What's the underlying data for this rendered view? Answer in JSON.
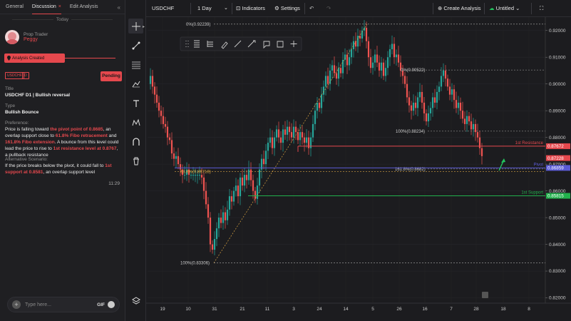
{
  "left_panel": {
    "tabs": [
      "General",
      "Discussion",
      "Edit Analysis"
    ],
    "tab_close": "×",
    "collapse": "«",
    "today": "Today",
    "author_role": "Prop Trader",
    "author_name": "Peggy",
    "status": "Analysis Created",
    "symbol_badge": "USDCHF",
    "timeframe_badge": "D",
    "pending_label": "Pending",
    "title_label": "Title",
    "title_value": "USDCHF D1 | Bullish reversal",
    "type_label": "Type",
    "type_value": "Bullish Bounce",
    "preference_label": "Preference:",
    "preference_text": [
      {
        "t": "Price is falling toward ",
        "hl": false
      },
      {
        "t": "the pivot point of 0.8685",
        "hl": true
      },
      {
        "t": ", an overlap support close to ",
        "hl": false
      },
      {
        "t": "61.8% Fibo retracement",
        "hl": true
      },
      {
        "t": " and ",
        "hl": false
      },
      {
        "t": "161.8% Fibo extension",
        "hl": true
      },
      {
        "t": ". A bounce from this level could lead the price to rise to ",
        "hl": false
      },
      {
        "t": "1st resistance level at 0.8767",
        "hl": true
      },
      {
        "t": ", a pullback resistance",
        "hl": false
      }
    ],
    "alt_label": "Alternative Scenario:",
    "alt_text": [
      {
        "t": "If the price breaks below the pivot, it could fall  to ",
        "hl": false
      },
      {
        "t": "1st support at 0.8581",
        "hl": true
      },
      {
        "t": ", an overlap support  level",
        "hl": false
      }
    ],
    "time": "11:29",
    "chat_placeholder": "Type here...",
    "chat_gif": "GIF"
  },
  "toolbar": {
    "symbol": "USDCHF",
    "timeframe": "1 Day",
    "indicators": "Indicators",
    "settings": "Settings",
    "create_analysis": "Create Analysis",
    "layout_name": "Untitled"
  },
  "chart_data": {
    "type": "candlestick",
    "symbol": "USDCHF",
    "timeframe": "D1",
    "ylim": [
      0.818,
      0.925
    ],
    "y_ticks": [
      "0.92000",
      "0.91000",
      "0.90000",
      "0.89000",
      "0.88000",
      "0.87000",
      "0.86000",
      "0.85000",
      "0.84000",
      "0.83000",
      "0.82000"
    ],
    "x_ticks": [
      "19",
      "10",
      "31",
      "21",
      "11",
      "3",
      "24",
      "14",
      "5",
      "26",
      "16",
      "7",
      "28",
      "18",
      "8"
    ],
    "price_tags": [
      {
        "label": "1st Resistance",
        "value": "0.87672",
        "color": "#e5484d"
      },
      {
        "label": "",
        "value": "0.87228",
        "color": "#e5484d"
      },
      {
        "label": "Pivot",
        "value": "0.86859",
        "color": "#5b5bd6"
      },
      {
        "label": "1st Support",
        "value": "0.85815",
        "color": "#22b14c"
      }
    ],
    "fib_labels": [
      "0%(0.92239)",
      "100%(0.83306)",
      "61.8%(0.86718)",
      "0%(0.90522)",
      "100%(0.88234)",
      "161.8%(0.8682)"
    ],
    "horizontal_levels": {
      "resistance": 0.87672,
      "pivot": 0.86859,
      "fib_618": 0.86718,
      "support": 0.85815
    },
    "colors": {
      "up": "#26a69a",
      "down": "#ef5350",
      "resistance": "#e5484d",
      "pivot": "#5b5bd6",
      "support": "#22b14c",
      "fib": "#d9a441",
      "arrow": "#22c55e"
    }
  }
}
